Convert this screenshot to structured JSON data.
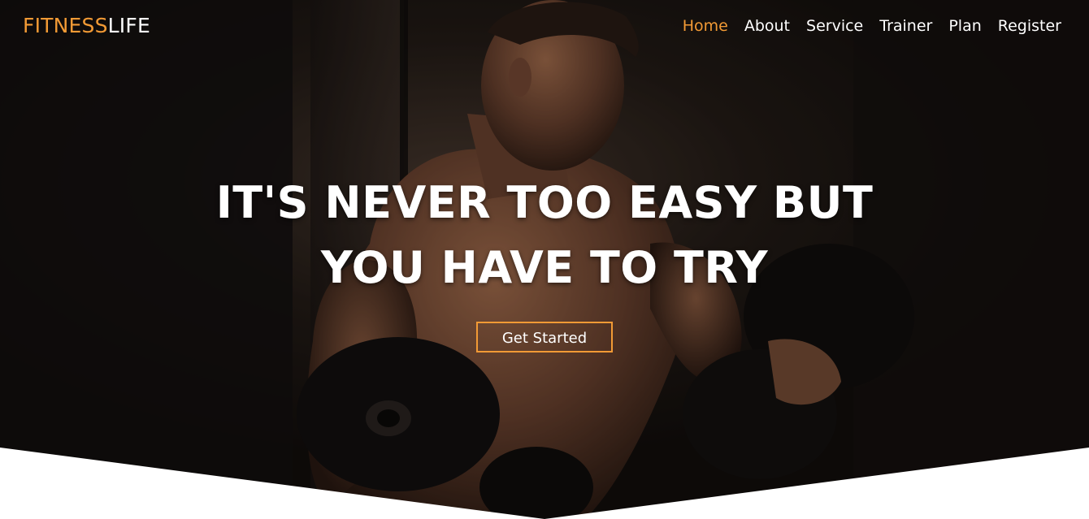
{
  "brand": {
    "part1": "FITNESS",
    "part2": "LIFE",
    "accent_color": "#f29a35"
  },
  "nav": {
    "items": [
      {
        "label": "Home",
        "active": true
      },
      {
        "label": "About",
        "active": false
      },
      {
        "label": "Service",
        "active": false
      },
      {
        "label": "Trainer",
        "active": false
      },
      {
        "label": "Plan",
        "active": false
      },
      {
        "label": "Register",
        "active": false
      }
    ]
  },
  "hero": {
    "headline_line1": "IT'S NEVER TOO EASY BUT",
    "headline_line2": "YOU HAVE TO TRY",
    "cta_label": "Get Started"
  },
  "colors": {
    "accent": "#f29a35",
    "text": "#ffffff",
    "background": "#15110f"
  }
}
